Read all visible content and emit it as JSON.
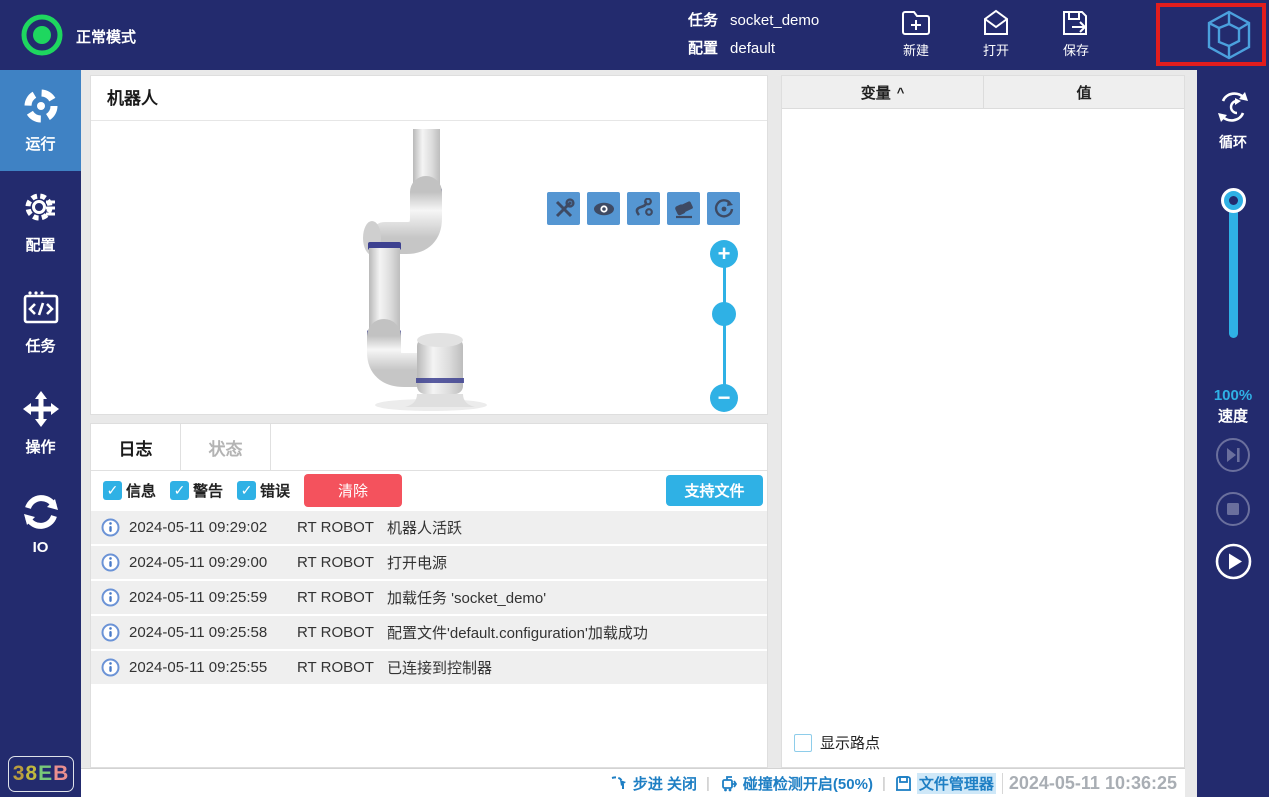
{
  "topbar": {
    "mode": "正常模式",
    "task_label": "任务",
    "task_value": "socket_demo",
    "config_label": "配置",
    "config_value": "default",
    "new_label": "新建",
    "open_label": "打开",
    "save_label": "保存"
  },
  "sidebar": {
    "items": [
      {
        "label": "运行"
      },
      {
        "label": "配置"
      },
      {
        "label": "任务"
      },
      {
        "label": "操作"
      },
      {
        "label": "IO"
      }
    ],
    "badge_chars": [
      {
        "ch": "3",
        "color": "#b99c3f"
      },
      {
        "ch": "8",
        "color": "#c0b83e"
      },
      {
        "ch": "E",
        "color": "#79c979"
      },
      {
        "ch": "B",
        "color": "#ea8f8f"
      }
    ]
  },
  "robot_panel": {
    "title": "机器人"
  },
  "log_panel": {
    "tab_log": "日志",
    "tab_status": "状态",
    "filter_info": "信息",
    "filter_warning": "警告",
    "filter_error": "错误",
    "check_mark": "✓",
    "clear_label": "清除",
    "support_label": "支持文件",
    "zoom_plus": "+",
    "zoom_minus": "−",
    "entries": [
      {
        "time": "2024-05-11 09:29:02",
        "source": "RT ROBOT",
        "message": "机器人活跃"
      },
      {
        "time": "2024-05-11 09:29:00",
        "source": "RT ROBOT",
        "message": "打开电源"
      },
      {
        "time": "2024-05-11 09:25:59",
        "source": "RT ROBOT",
        "message": "加载任务 'socket_demo'"
      },
      {
        "time": "2024-05-11 09:25:58",
        "source": "RT ROBOT",
        "message": "配置文件'default.configuration'加载成功"
      },
      {
        "time": "2024-05-11 09:25:55",
        "source": "RT ROBOT",
        "message": "已连接到控制器"
      }
    ]
  },
  "variables_panel": {
    "col_variable": "变量",
    "sort_caret": "^",
    "col_value": "值",
    "show_waypoints": "显示路点"
  },
  "right_rail": {
    "loop_label": "循环",
    "speed_value": "100%",
    "speed_label": "速度"
  },
  "statusbar": {
    "step_text": "步进 关闭",
    "separator": "|",
    "collision_text": "碰撞检测开启(50%)",
    "file_manager_text": "文件管理器",
    "timestamp": "2024-05-11 10:36:25"
  },
  "colors": {
    "navy": "#232b6e",
    "active_item_blue": "#3f82c4",
    "accent_blue": "#2fb1e5",
    "toolbar_button_blue": "#5596d2",
    "danger_red": "#f4525d",
    "status_green": "#1ed75f",
    "highlight_red": "#e11d1d",
    "status_text_blue": "#1e7fc4"
  }
}
